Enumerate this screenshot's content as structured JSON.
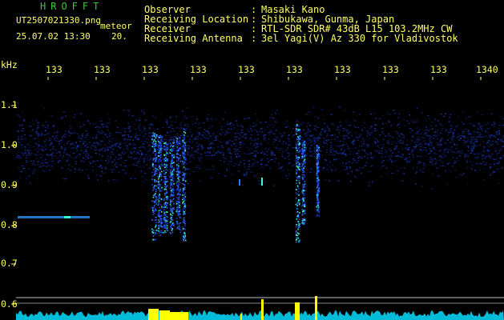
{
  "app": {
    "title": "HROFFT",
    "filename": "UT2507021330.png",
    "tag": "meteor",
    "datetime": "25.07.02 13:30",
    "count": "20."
  },
  "station": {
    "fields": [
      {
        "label": "Observer",
        "value": "Masaki Kano"
      },
      {
        "label": "Receiving Location",
        "value": "Shibukawa, Gunma, Japan"
      },
      {
        "label": "Receiver",
        "value": "RTL-SDR SDR# 43dB L15 103.2MHz CW"
      },
      {
        "label": "Receiving Antenna",
        "value": "3el Yagi(V) Az 330 for Vladivostok"
      }
    ]
  },
  "axes": {
    "y_unit": "kHz",
    "time_ticks": [
      "133",
      "133",
      "133",
      "133",
      "133",
      "133",
      "133",
      "133",
      "133",
      "1340"
    ],
    "freq_ticks": [
      "1.1",
      "1.0",
      "0.9",
      "0.8",
      "0.7",
      "0.6"
    ]
  },
  "colors": {
    "background": "#000000",
    "text": "#ffff66",
    "title": "#33cc33",
    "noise": "#0a1a80",
    "echo_hot": "#33ffcc",
    "power_trace": "#00ddff",
    "power_peak": "#ffff00"
  }
}
